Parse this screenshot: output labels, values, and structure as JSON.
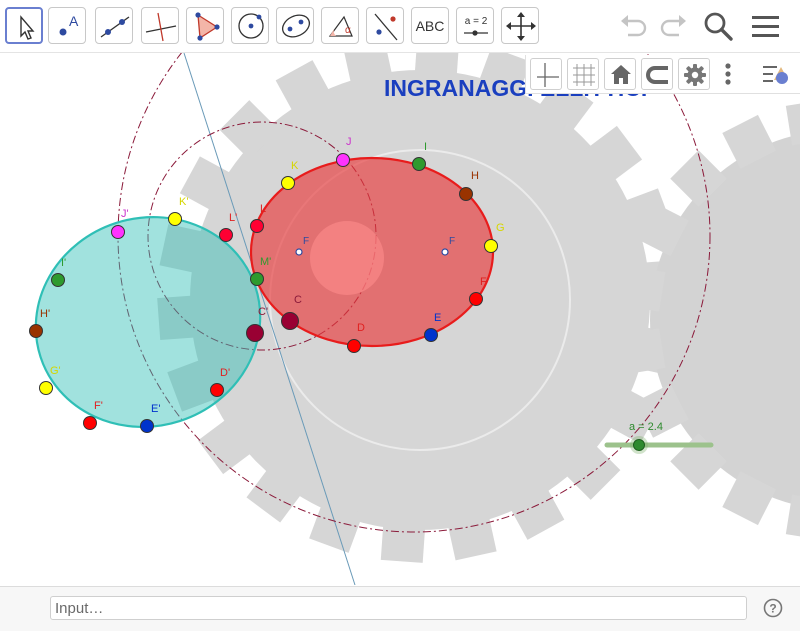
{
  "toolbar": {
    "tools": [
      {
        "id": "move",
        "icon": "move-cursor-icon",
        "selected": true
      },
      {
        "id": "point",
        "icon": "point-icon",
        "label": "A"
      },
      {
        "id": "line",
        "icon": "line-icon"
      },
      {
        "id": "perpendicular",
        "icon": "perpendicular-line-icon"
      },
      {
        "id": "polygon",
        "icon": "polygon-icon"
      },
      {
        "id": "circle",
        "icon": "circle-with-center-icon"
      },
      {
        "id": "ellipse",
        "icon": "ellipse-icon"
      },
      {
        "id": "angle",
        "icon": "angle-icon",
        "label": "α"
      },
      {
        "id": "reflect",
        "icon": "reflect-about-line-icon"
      },
      {
        "id": "text",
        "icon": "text-tool-icon",
        "label": "ABC"
      },
      {
        "id": "slider",
        "icon": "slider-tool-icon",
        "label": "a = 2"
      },
      {
        "id": "move-view",
        "icon": "move-graphics-view-icon"
      }
    ],
    "right_icons": [
      "undo-icon",
      "redo-icon",
      "search-icon",
      "menu-icon"
    ]
  },
  "graphics_bar": {
    "icons": [
      "axes-icon",
      "grid-icon",
      "home-icon",
      "point-capture-icon",
      "gear-icon",
      "more-vertical-icon",
      "style-bar-toggle-icon"
    ]
  },
  "canvas": {
    "title": "INGRANAGGI ELLITTICI",
    "slider": {
      "label": "a = 2.4",
      "value": 2.4,
      "color": "#7ab06a"
    },
    "colors": {
      "red_ellipse": "#e8393a",
      "teal_ellipse": "#2fbfb6",
      "gear": "#d6d6d6"
    },
    "points_red": [
      {
        "label": "J",
        "color": "#ff33ff"
      },
      {
        "label": "I",
        "color": "#2e9a2e"
      },
      {
        "label": "H",
        "color": "#993300"
      },
      {
        "label": "G",
        "color": "#ffff00"
      },
      {
        "label": "F",
        "color": "#ff0000"
      },
      {
        "label": "E",
        "color": "#0033cc"
      },
      {
        "label": "D",
        "color": "#ff0000"
      },
      {
        "label": "C",
        "color": "#990033"
      },
      {
        "label": "K",
        "color": "#ffff00"
      },
      {
        "label": "L",
        "color": "#ff0033"
      }
    ],
    "points_teal": [
      {
        "label": "J'",
        "color": "#ff33ff"
      },
      {
        "label": "K'",
        "color": "#ffff00"
      },
      {
        "label": "L'",
        "color": "#ff0033"
      },
      {
        "label": "M'",
        "color": "#2e9a2e"
      },
      {
        "label": "I'",
        "color": "#2e9a2e"
      },
      {
        "label": "H'",
        "color": "#993300"
      },
      {
        "label": "G'",
        "color": "#ffff00"
      },
      {
        "label": "F'",
        "color": "#ff0000"
      },
      {
        "label": "E'",
        "color": "#0033cc"
      },
      {
        "label": "D'",
        "color": "#ff0000"
      },
      {
        "label": "C'",
        "color": "#990033"
      }
    ],
    "focus_labels": [
      "F",
      "F"
    ]
  },
  "input": {
    "placeholder": "Input…"
  },
  "help": {
    "icon": "help-icon"
  }
}
